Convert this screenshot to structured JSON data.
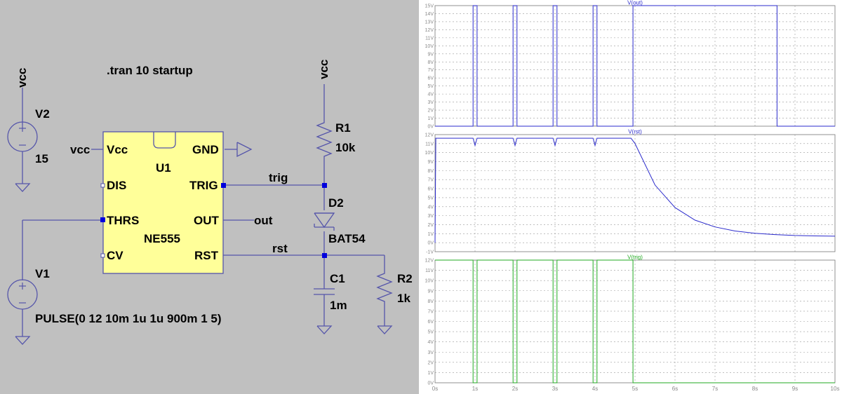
{
  "schematic": {
    "directive": ".tran 10 startup",
    "v2": {
      "name": "V2",
      "value": "15",
      "net": "vcc"
    },
    "v1": {
      "name": "V1",
      "value": "PULSE(0 12 10m 1u 1u 900m 1 5)"
    },
    "ic": {
      "name": "U1",
      "model": "NE555",
      "pins": {
        "vcc": "Vcc",
        "gnd": "GND",
        "dis": "DIS",
        "trig": "TRIG",
        "thrs": "THRS",
        "out": "OUT",
        "cv": "CV",
        "rst": "RST"
      }
    },
    "nets": {
      "vcc_left": "vcc",
      "vcc_top": "vcc",
      "trig": "trig",
      "out": "out",
      "rst": "rst"
    },
    "r1": {
      "name": "R1",
      "value": "10k"
    },
    "d2": {
      "name": "D2",
      "value": "BAT54"
    },
    "c1": {
      "name": "C1",
      "value": "1m"
    },
    "r2": {
      "name": "R2",
      "value": "1k"
    }
  },
  "plots": [
    {
      "title": "V(out)",
      "color": "#2b2bcc",
      "yticks": [
        "15V",
        "14V",
        "13V",
        "12V",
        "11V",
        "10V",
        "9V",
        "8V",
        "7V",
        "6V",
        "5V",
        "4V",
        "3V",
        "2V",
        "1V",
        "0V"
      ]
    },
    {
      "title": "V(rst)",
      "color": "#2b2bcc",
      "yticks": [
        "12V",
        "11V",
        "10V",
        "9V",
        "8V",
        "7V",
        "6V",
        "5V",
        "4V",
        "3V",
        "2V",
        "1V",
        "0V",
        "-1V"
      ]
    },
    {
      "title": "V(trig)",
      "color": "#22aa22",
      "yticks": [
        "12V",
        "11V",
        "10V",
        "9V",
        "8V",
        "7V",
        "6V",
        "5V",
        "4V",
        "3V",
        "2V",
        "1V",
        "0V"
      ]
    }
  ],
  "xticks": [
    "0s",
    "1s",
    "2s",
    "3s",
    "4s",
    "5s",
    "6s",
    "7s",
    "8s",
    "9s",
    "10s"
  ],
  "chart_data": [
    {
      "type": "line",
      "title": "V(out)",
      "xlim": [
        0,
        10
      ],
      "ylim": [
        0,
        15
      ],
      "series": [
        {
          "name": "V(out)",
          "x": [
            0,
            0.95,
            0.95,
            1.05,
            1.05,
            1.95,
            1.95,
            2.05,
            2.05,
            2.95,
            2.95,
            3.05,
            3.05,
            3.95,
            3.95,
            4.05,
            4.05,
            4.95,
            4.95,
            8.55,
            8.55,
            10
          ],
          "y": [
            0,
            0,
            15,
            15,
            0,
            0,
            15,
            15,
            0,
            0,
            15,
            15,
            0,
            0,
            15,
            15,
            0,
            0,
            15,
            15,
            0,
            0
          ]
        }
      ]
    },
    {
      "type": "line",
      "title": "V(rst)",
      "xlim": [
        0,
        10
      ],
      "ylim": [
        -1,
        12
      ],
      "series": [
        {
          "name": "V(rst)",
          "x": [
            0,
            0.02,
            0.05,
            0.95,
            1.0,
            1.05,
            1.95,
            2.0,
            2.05,
            2.95,
            3.0,
            3.05,
            3.95,
            4.0,
            4.05,
            4.9,
            5.0,
            5.5,
            6.0,
            6.5,
            7.0,
            7.5,
            8.0,
            8.5,
            9.0,
            9.5,
            10.0
          ],
          "y": [
            0,
            11.6,
            11.6,
            11.6,
            10.8,
            11.6,
            11.6,
            10.8,
            11.6,
            11.6,
            10.8,
            11.6,
            11.6,
            10.8,
            11.6,
            11.6,
            11.0,
            6.4,
            3.9,
            2.5,
            1.75,
            1.3,
            1.05,
            0.9,
            0.8,
            0.75,
            0.72
          ]
        }
      ]
    },
    {
      "type": "line",
      "title": "V(trig)",
      "xlim": [
        0,
        10
      ],
      "ylim": [
        0,
        12
      ],
      "series": [
        {
          "name": "V(trig)",
          "x": [
            0,
            0.95,
            0.95,
            1.05,
            1.05,
            1.95,
            1.95,
            2.05,
            2.05,
            2.95,
            2.95,
            3.05,
            3.05,
            3.95,
            3.95,
            4.05,
            4.05,
            4.95,
            4.95,
            10
          ],
          "y": [
            12,
            12,
            0,
            0,
            12,
            12,
            0,
            0,
            12,
            12,
            0,
            0,
            12,
            12,
            0,
            0,
            12,
            12,
            0,
            0
          ]
        }
      ]
    }
  ]
}
